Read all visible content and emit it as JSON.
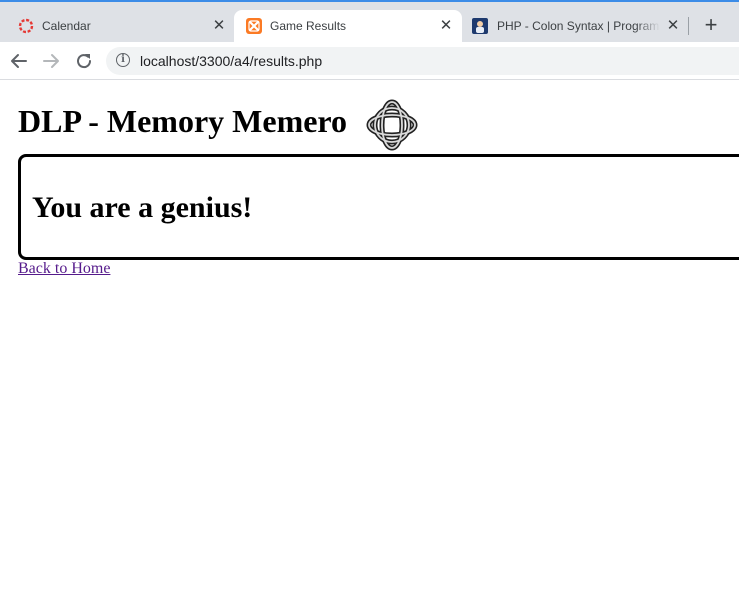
{
  "browser": {
    "tabs": [
      {
        "title": "Calendar",
        "icon": "calendar-favicon-icon",
        "active": false
      },
      {
        "title": "Game Results",
        "icon": "xampp-favicon-icon",
        "active": true
      },
      {
        "title": "PHP - Colon Syntax | Programs",
        "icon": "site-favicon-icon",
        "active": false
      }
    ],
    "close_glyph": "✕",
    "new_tab_glyph": "+",
    "url": "localhost/3300/a4/results.php",
    "colors": {
      "tabstrip": "#dee1e6",
      "accent": "#3c8ce7",
      "omnibox": "#f1f3f4"
    }
  },
  "page": {
    "title": "DLP - Memory Memero",
    "logo_icon": "celtic-knot-logo-icon",
    "result_message": "You are a genius!",
    "back_link": "Back to Home",
    "colors": {
      "link_visited": "#551a8b",
      "text": "#000000"
    }
  }
}
